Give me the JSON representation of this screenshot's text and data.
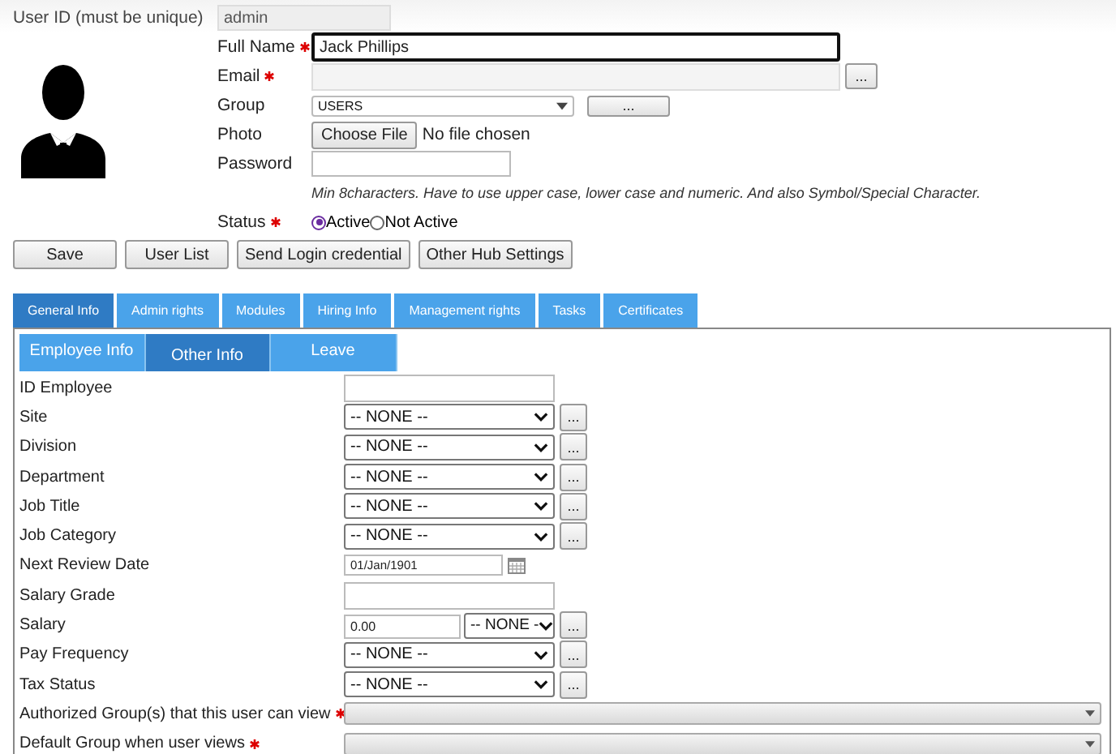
{
  "user_id": {
    "label": "User ID (must be unique)",
    "value": "admin"
  },
  "fields": [
    {
      "kind": "text",
      "label": "Full Name",
      "required": true,
      "focused": true,
      "value": "Jack Phillips"
    },
    {
      "kind": "lookup",
      "label": "Email",
      "required": true,
      "button": "..."
    },
    {
      "kind": "select",
      "label": "Group",
      "required": false,
      "value": "USERS",
      "button": "..."
    },
    {
      "kind": "file",
      "label": "Photo",
      "required": false,
      "button": "Choose File",
      "status": "No file chosen"
    },
    {
      "kind": "password",
      "label": "Password",
      "required": false
    }
  ],
  "password_hint": "Min 8characters. Have to use upper case, lower case and numeric. And also Symbol/Special Character.",
  "status": {
    "label": "Status",
    "required": true,
    "options": [
      {
        "label": "Active",
        "selected": true
      },
      {
        "label": "Not Active",
        "selected": false
      }
    ]
  },
  "buttons": [
    "Save",
    "User List",
    "Send Login credential",
    "Other Hub Settings"
  ],
  "tabs": [
    {
      "label": "General Info",
      "selected": true
    },
    {
      "label": "Admin rights",
      "selected": false
    },
    {
      "label": "Modules",
      "selected": false
    },
    {
      "label": "Hiring Info",
      "selected": false
    },
    {
      "label": "Management rights",
      "selected": false
    },
    {
      "label": "Tasks",
      "selected": false
    },
    {
      "label": "Certificates",
      "selected": false
    }
  ],
  "subtabs": [
    {
      "label": "Employee Info",
      "selected": false
    },
    {
      "label": "Other Info",
      "selected": true
    },
    {
      "label": "Leave",
      "selected": false
    }
  ],
  "rows": [
    {
      "kind": "text",
      "label": "ID Employee",
      "required": false
    },
    {
      "kind": "select",
      "label": "Site",
      "required": false,
      "value": "-- NONE --",
      "button": "..."
    },
    {
      "kind": "select",
      "label": "Division",
      "required": false,
      "value": "-- NONE --",
      "button": "..."
    },
    {
      "kind": "select",
      "label": "Department",
      "required": false,
      "value": "-- NONE --",
      "button": "..."
    },
    {
      "kind": "select",
      "label": "Job Title",
      "required": false,
      "value": "-- NONE --",
      "button": "..."
    },
    {
      "kind": "select",
      "label": "Job Category",
      "required": false,
      "value": "-- NONE --",
      "button": "..."
    },
    {
      "kind": "date",
      "label": "Next Review Date",
      "required": false,
      "value": "01/Jan/1901"
    },
    {
      "kind": "text",
      "label": "Salary Grade",
      "required": false
    },
    {
      "kind": "money",
      "label": "Salary",
      "required": false,
      "value": "0.00",
      "unit": "-- NONE -",
      "button": "..."
    },
    {
      "kind": "select",
      "label": "Pay Frequency",
      "required": false,
      "value": "-- NONE --",
      "button": "..."
    },
    {
      "kind": "select",
      "label": "Tax Status",
      "required": false,
      "value": "-- NONE --",
      "button": "..."
    },
    {
      "kind": "wide",
      "label": "Authorized Group(s) that this user can view",
      "required": true
    },
    {
      "kind": "wide",
      "label": "Default Group when user views",
      "required": true
    }
  ]
}
